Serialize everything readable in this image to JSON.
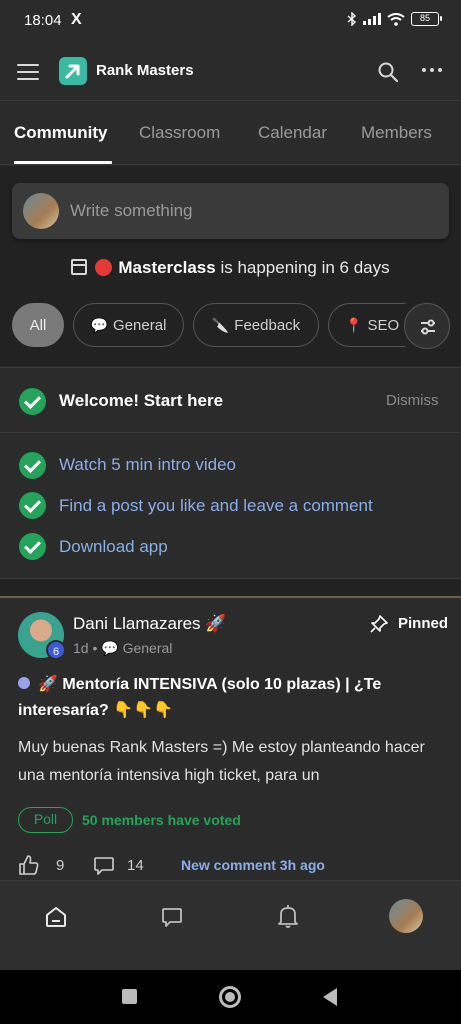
{
  "status_bar": {
    "time": "18:04",
    "x_icon": "X",
    "battery": "85"
  },
  "app_bar": {
    "title": "Rank Masters"
  },
  "tabs": [
    {
      "label": "Community",
      "active": true
    },
    {
      "label": "Classroom"
    },
    {
      "label": "Calendar"
    },
    {
      "label": "Members"
    }
  ],
  "compose": {
    "placeholder": "Write something"
  },
  "event": {
    "name": "Masterclass",
    "suffix": " is happening in 6 days"
  },
  "chips": [
    {
      "label": "All",
      "active": true
    },
    {
      "label": "General",
      "icon": "💬"
    },
    {
      "label": "Feedback",
      "icon": "🔪"
    },
    {
      "label": "SEO",
      "icon": "📍"
    }
  ],
  "welcome": {
    "title": "Welcome! Start here",
    "dismiss": "Dismiss",
    "tasks": [
      "Watch 5 min intro video",
      "Find a post you like and leave a comment",
      "Download app"
    ]
  },
  "post": {
    "author": "Dani Llamazares 🚀",
    "level": "6",
    "meta": "1d • 💬 General",
    "pinned": "Pinned",
    "title": "🚀 Mentoría INTENSIVA (solo 10 plazas) | ¿Te interesaría? 👇👇👇",
    "body": "Muy buenas Rank Masters =) Me estoy planteando hacer una mentoría intensiva high ticket, para un",
    "poll_label": "Poll",
    "voted": "50 members have voted",
    "likes": "9",
    "comments": "14",
    "new_comment": "New comment 3h ago"
  },
  "colors": {
    "accent_green": "#24a35a",
    "link_blue": "#8aaee8",
    "logo_teal": "#3ab9a3",
    "event_red": "#e53935"
  }
}
